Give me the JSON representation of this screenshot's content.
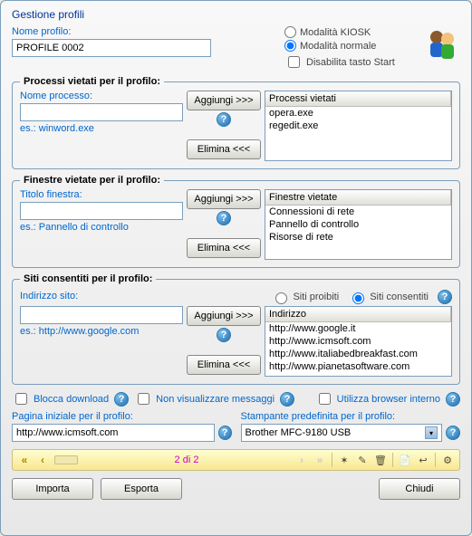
{
  "window": {
    "title": "Gestione profili"
  },
  "profile": {
    "name_label": "Nome profilo:",
    "name_value": "PROFILE 0002"
  },
  "mode": {
    "kiosk": "Modalità KIOSK",
    "normal": "Modalità normale",
    "disable_start": "Disabilita tasto Start"
  },
  "processes": {
    "legend": "Processi vietati per il profilo:",
    "field_label": "Nome processo:",
    "hint": "es.: winword.exe",
    "add": "Aggiungi >>>",
    "remove": "Elimina <<<",
    "header": "Processi vietati",
    "items": [
      "opera.exe",
      "regedit.exe"
    ]
  },
  "windows": {
    "legend": "Finestre vietate per il profilo:",
    "field_label": "Titolo finestra:",
    "hint": "es.: Pannello di controllo",
    "add": "Aggiungi >>>",
    "remove": "Elimina <<<",
    "header": "Finestre vietate",
    "items": [
      "Connessioni di rete",
      "Pannello di controllo",
      "Risorse di rete"
    ]
  },
  "sites": {
    "legend": "Siti consentiti per il profilo:",
    "forbidden": "Siti proibiti",
    "allowed": "Siti consentiti",
    "field_label": "Indirizzo sito:",
    "hint": "es.: http://www.google.com",
    "add": "Aggiungi >>>",
    "remove": "Elimina <<<",
    "header": "Indirizzo",
    "items": [
      "http://www.google.it",
      "http://www.icmsoft.com",
      "http://www.italiabedbreakfast.com",
      "http://www.pianetasoftware.com"
    ]
  },
  "options": {
    "block_download": "Blocca download",
    "hide_messages": "Non visualizzare messaggi",
    "internal_browser": "Utilizza browser interno"
  },
  "homepage": {
    "label": "Pagina iniziale per il profilo:",
    "value": "http://www.icmsoft.com"
  },
  "printer": {
    "label": "Stampante predefinita per il profilo:",
    "value": "Brother MFC-9180 USB"
  },
  "nav": {
    "counter": "2 di 2"
  },
  "buttons": {
    "import": "Importa",
    "export": "Esporta",
    "close": "Chiudi"
  }
}
